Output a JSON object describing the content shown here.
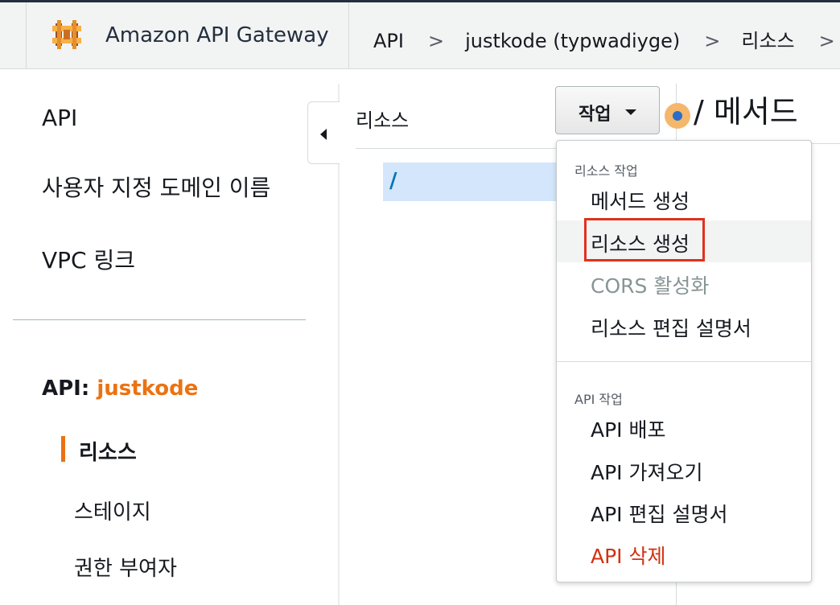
{
  "header": {
    "brand": "Amazon API Gateway",
    "breadcrumbs": [
      "API",
      "justkode (typwadiyge)",
      "리소스"
    ],
    "separator": ">",
    "logo_icon": "api-gateway-logo"
  },
  "sidebar": {
    "items": [
      {
        "label": "API"
      },
      {
        "label": "사용자 지정 도메인 이름"
      },
      {
        "label": "VPC 링크"
      }
    ],
    "api_prefix": "API:",
    "api_name": "justkode",
    "sub_items": [
      {
        "label": "리소스",
        "active": true
      },
      {
        "label": "스테이지",
        "active": false
      },
      {
        "label": "권한 부여자",
        "active": false
      }
    ]
  },
  "resources": {
    "title": "리소스",
    "tree": [
      {
        "label": "/",
        "selected": true
      }
    ]
  },
  "actions": {
    "label": "작업",
    "open": true,
    "groups": [
      {
        "title": "리소스 작업",
        "items": [
          {
            "label": "메서드 생성",
            "state": "normal"
          },
          {
            "label": "리소스 생성",
            "state": "highlighted"
          },
          {
            "label": "CORS 활성화",
            "state": "disabled"
          },
          {
            "label": "리소스 편집 설명서",
            "state": "normal"
          }
        ]
      },
      {
        "title": "API 작업",
        "items": [
          {
            "label": "API 배포",
            "state": "normal"
          },
          {
            "label": "API 가져오기",
            "state": "normal"
          },
          {
            "label": "API 편집 설명서",
            "state": "normal"
          },
          {
            "label": "API 삭제",
            "state": "danger"
          }
        ]
      }
    ]
  },
  "methods_panel": {
    "title": "/ 메서드"
  },
  "colors": {
    "accent": "#ec7211",
    "danger": "#d13212",
    "highlight_box": "#e0321c",
    "selected_row": "#d3e6fb",
    "link_blue": "#0073bb"
  }
}
